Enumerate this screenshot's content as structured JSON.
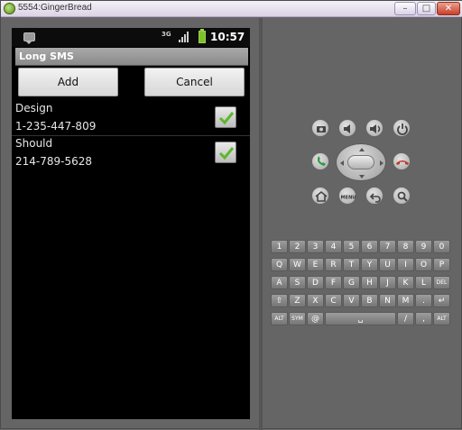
{
  "window": {
    "title": "5554:GingerBread",
    "minimize": "–",
    "maximize": "□",
    "close": "✕"
  },
  "status_bar": {
    "network_label": "3G",
    "time": "10:57"
  },
  "app": {
    "title": "Long SMS",
    "add_label": "Add",
    "cancel_label": "Cancel"
  },
  "contacts": [
    {
      "name": "Design",
      "phone": "1-235-447-809",
      "checked": true
    },
    {
      "name": "Should",
      "phone": "214-789-5628",
      "checked": true
    }
  ],
  "colors": {
    "check": "#5bb82b",
    "call_green": "#2e9a3c",
    "call_red": "#c0392b"
  },
  "controls": {
    "menu_label": "MENU"
  },
  "keyboard": {
    "row1": [
      "1",
      "2",
      "3",
      "4",
      "5",
      "6",
      "7",
      "8",
      "9",
      "0"
    ],
    "row1_symbols": [
      "!",
      "@",
      "#",
      "$",
      "%",
      "^",
      "&",
      "*",
      "(",
      ")"
    ],
    "row2": [
      "Q",
      "W",
      "E",
      "R",
      "T",
      "Y",
      "U",
      "I",
      "O",
      "P"
    ],
    "row2_symbols": [
      "~",
      "\"",
      "{",
      "}",
      "[",
      "]",
      "<",
      ">",
      "=",
      "_"
    ],
    "row3": [
      "A",
      "S",
      "D",
      "F",
      "G",
      "H",
      "J",
      "K",
      "L",
      "DEL"
    ],
    "row3_symbols": [
      "",
      "\\",
      "|",
      "",
      "",
      "",
      "",
      "",
      ""
    ],
    "row4": [
      "⇧",
      "Z",
      "X",
      "C",
      "V",
      "B",
      "N",
      "M",
      ".",
      "↵"
    ],
    "row4_symbols": [
      "",
      "",
      "",
      "",
      "",
      "",
      "",
      "",
      "?",
      ""
    ],
    "row5": [
      "ALT",
      "SYM",
      "@",
      "␣",
      "/",
      ",",
      "ALT"
    ]
  }
}
